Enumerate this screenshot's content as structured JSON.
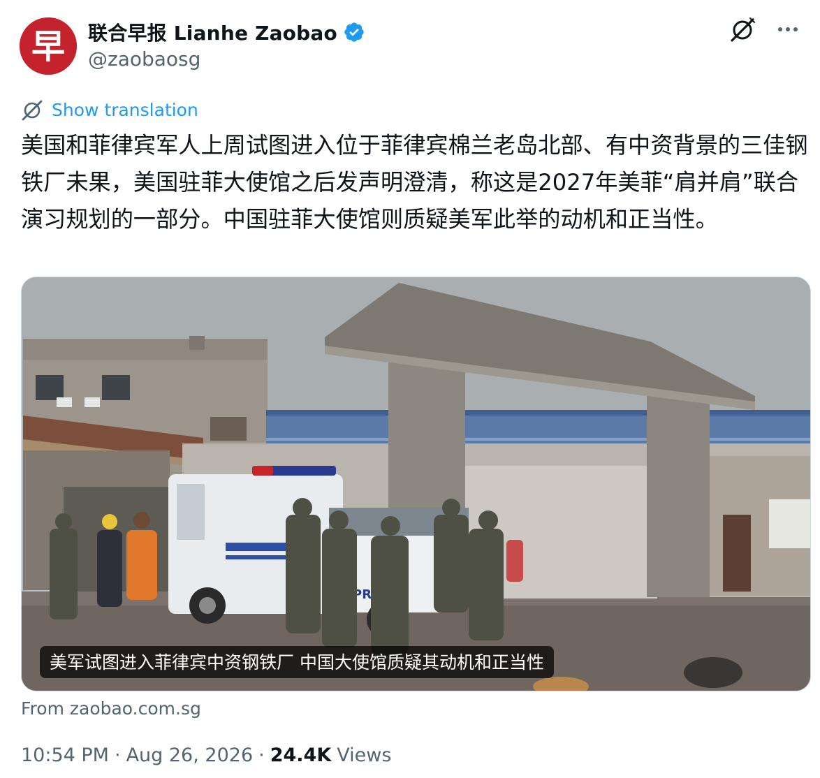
{
  "account": {
    "display_name": "联合早报 Lianhe Zaobao",
    "handle": "@zaobaosg",
    "avatar_glyph": "早",
    "avatar_color": "#c4222c",
    "verified_color": "#1d9bf0"
  },
  "actions": {
    "grok_icon": "grok-icon",
    "more_icon": "more-icon"
  },
  "translation": {
    "link_text": "Show translation",
    "link_color": "#1d9bf0"
  },
  "tweet": {
    "text": "美国和菲律宾军人上周试图进入位于菲律宾棉兰老岛北部、有中资背景的三佳钢铁厂未果，美国驻菲大使馆之后发声明澄清，称这是2027年美菲“肩并肩”联合演习规划的一部分。中国驻菲大使馆则质疑美军此举的动机和正当性。"
  },
  "media": {
    "caption": "美军试图进入菲律宾中资钢铁厂 中国大使馆质疑其动机和正当性",
    "vehicle_text": "PRO"
  },
  "card": {
    "source": "From zaobao.com.sg"
  },
  "meta": {
    "time": "10:54 PM",
    "separator": "·",
    "date": "Aug 26, 2026",
    "views_count": "24.4K",
    "views_label": "Views"
  }
}
